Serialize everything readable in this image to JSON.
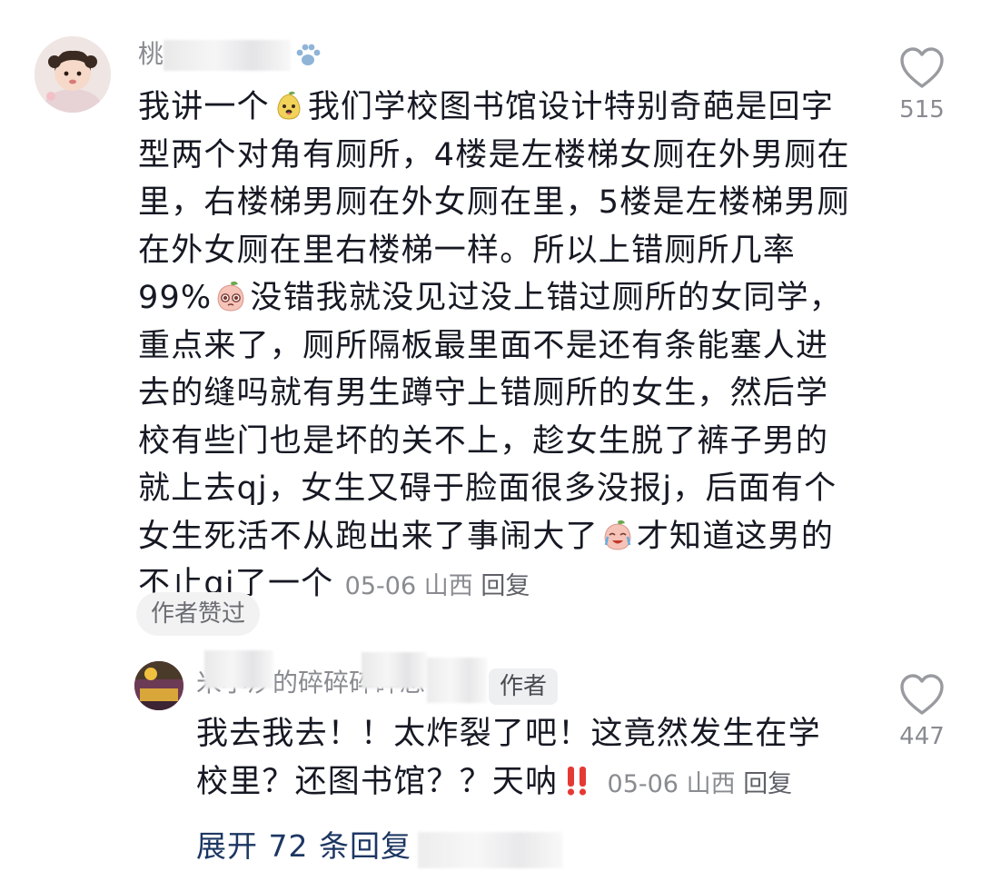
{
  "comment": {
    "username": "桃",
    "text_parts": [
      "我讲一个",
      "我们学校图书馆设计特别奇葩是回字型两个对角有厕所，4楼是左楼梯女厕在外男厕在里，右楼梯男厕在外女厕在里，5楼是左楼梯男厕在外女厕在里右楼梯一样。所以上错厕所几率99%",
      "没错我就没见过没上错过厕所的女同学，重点来了，厕所隔板最里面不是还有条能塞人进去的缝吗就有男生蹲守上错厕所的女生，然后学校有些门也是坏的关不上，趁女生脱了裤子男的就上去qj，女生又碍于脸面很多没报j，后面有个女生死活不从跑出来了事闹大了",
      "才知道这男的不止qj了一个"
    ],
    "date": "05-06",
    "location": "山西",
    "reply_label": "回复",
    "author_liked": "作者赞过",
    "likes": "515",
    "icons": [
      "paw-emoji",
      "pear-dog-emoji",
      "peach-pleading-emoji",
      "peach-crying-emoji"
    ]
  },
  "reply": {
    "username": "米小汐的碎碎碎碎念",
    "author_tag": "作者",
    "text_parts": [
      "我去我去！！太炸裂了吧！这竟然发生在学校里？还图书馆？？天呐"
    ],
    "date": "05-06",
    "location": "山西",
    "reply_label": "回复",
    "likes": "447",
    "icons": [
      "double-exclamation-emoji"
    ]
  },
  "expand_replies": "展开 72 条回复",
  "colors": {
    "text": "#161823",
    "meta": "#8a8b91",
    "link": "#1d3763"
  }
}
